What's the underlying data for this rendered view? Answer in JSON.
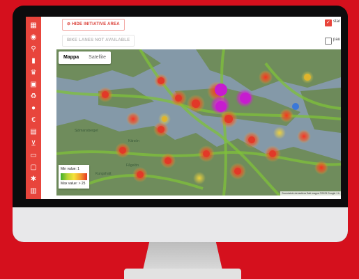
{
  "buttons": {
    "hide_initiative": "HIDE INITIATIVE AREA",
    "bike_lanes": "BIKE LANES NOT AVAILABLE"
  },
  "checkboxes": {
    "first_label": "star",
    "second_label": "pau"
  },
  "map": {
    "tabs": [
      "Mappa",
      "Satellite"
    ],
    "active_tab": "Mappa",
    "places": [
      "Sjömansberget",
      "Kärsön",
      "Fågelön",
      "Kungshatt"
    ],
    "legend": {
      "min": "Min value: 1",
      "max": "Max value: > 25"
    },
    "attribution": "Scorciatoie da tastiera   Dati mappa ©2023 Google   1 k"
  },
  "sidebar_icons": [
    "dashboard-icon",
    "people-icon",
    "bike-icon",
    "chart-icon",
    "trophy-icon",
    "badge-icon",
    "recycle-icon",
    "bulb-icon",
    "euro-icon",
    "calendar-icon",
    "cart-icon",
    "label-icon",
    "chat-icon",
    "settings-icon",
    "report-icon"
  ],
  "colors": {
    "accent": "#e8453c",
    "background": "#d5101d"
  }
}
